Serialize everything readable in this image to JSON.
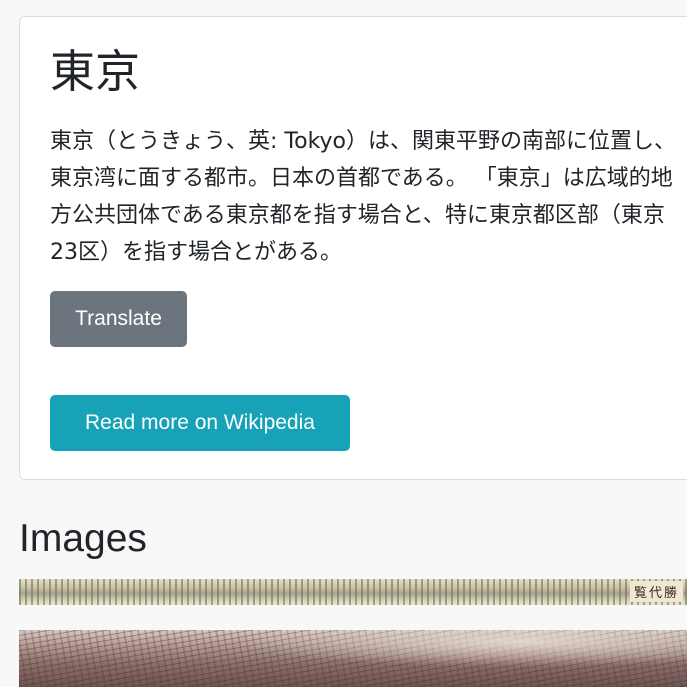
{
  "article": {
    "title": "東京",
    "summary": "東京（とうきょう、英: Tokyo）は、関東平野の南部に位置し、東京湾に面する都市。日本の首都である。 「東京」は広域的地方公共団体である東京都を指す場合と、特に東京都区部（東京23区）を指す場合とがある。",
    "translate_label": "Translate",
    "wiki_label": "Read more on Wikipedia"
  },
  "images_section": {
    "heading": "Images",
    "items": [
      {
        "description": "panoramic-scroll-image",
        "caption_glyphs": "覧代勝"
      },
      {
        "description": "aerial-city-photo"
      }
    ]
  },
  "colors": {
    "translate_button": "#6c757d",
    "wiki_button": "#17a2b8",
    "page_background": "#f8f8f8",
    "card_background": "#ffffff"
  }
}
